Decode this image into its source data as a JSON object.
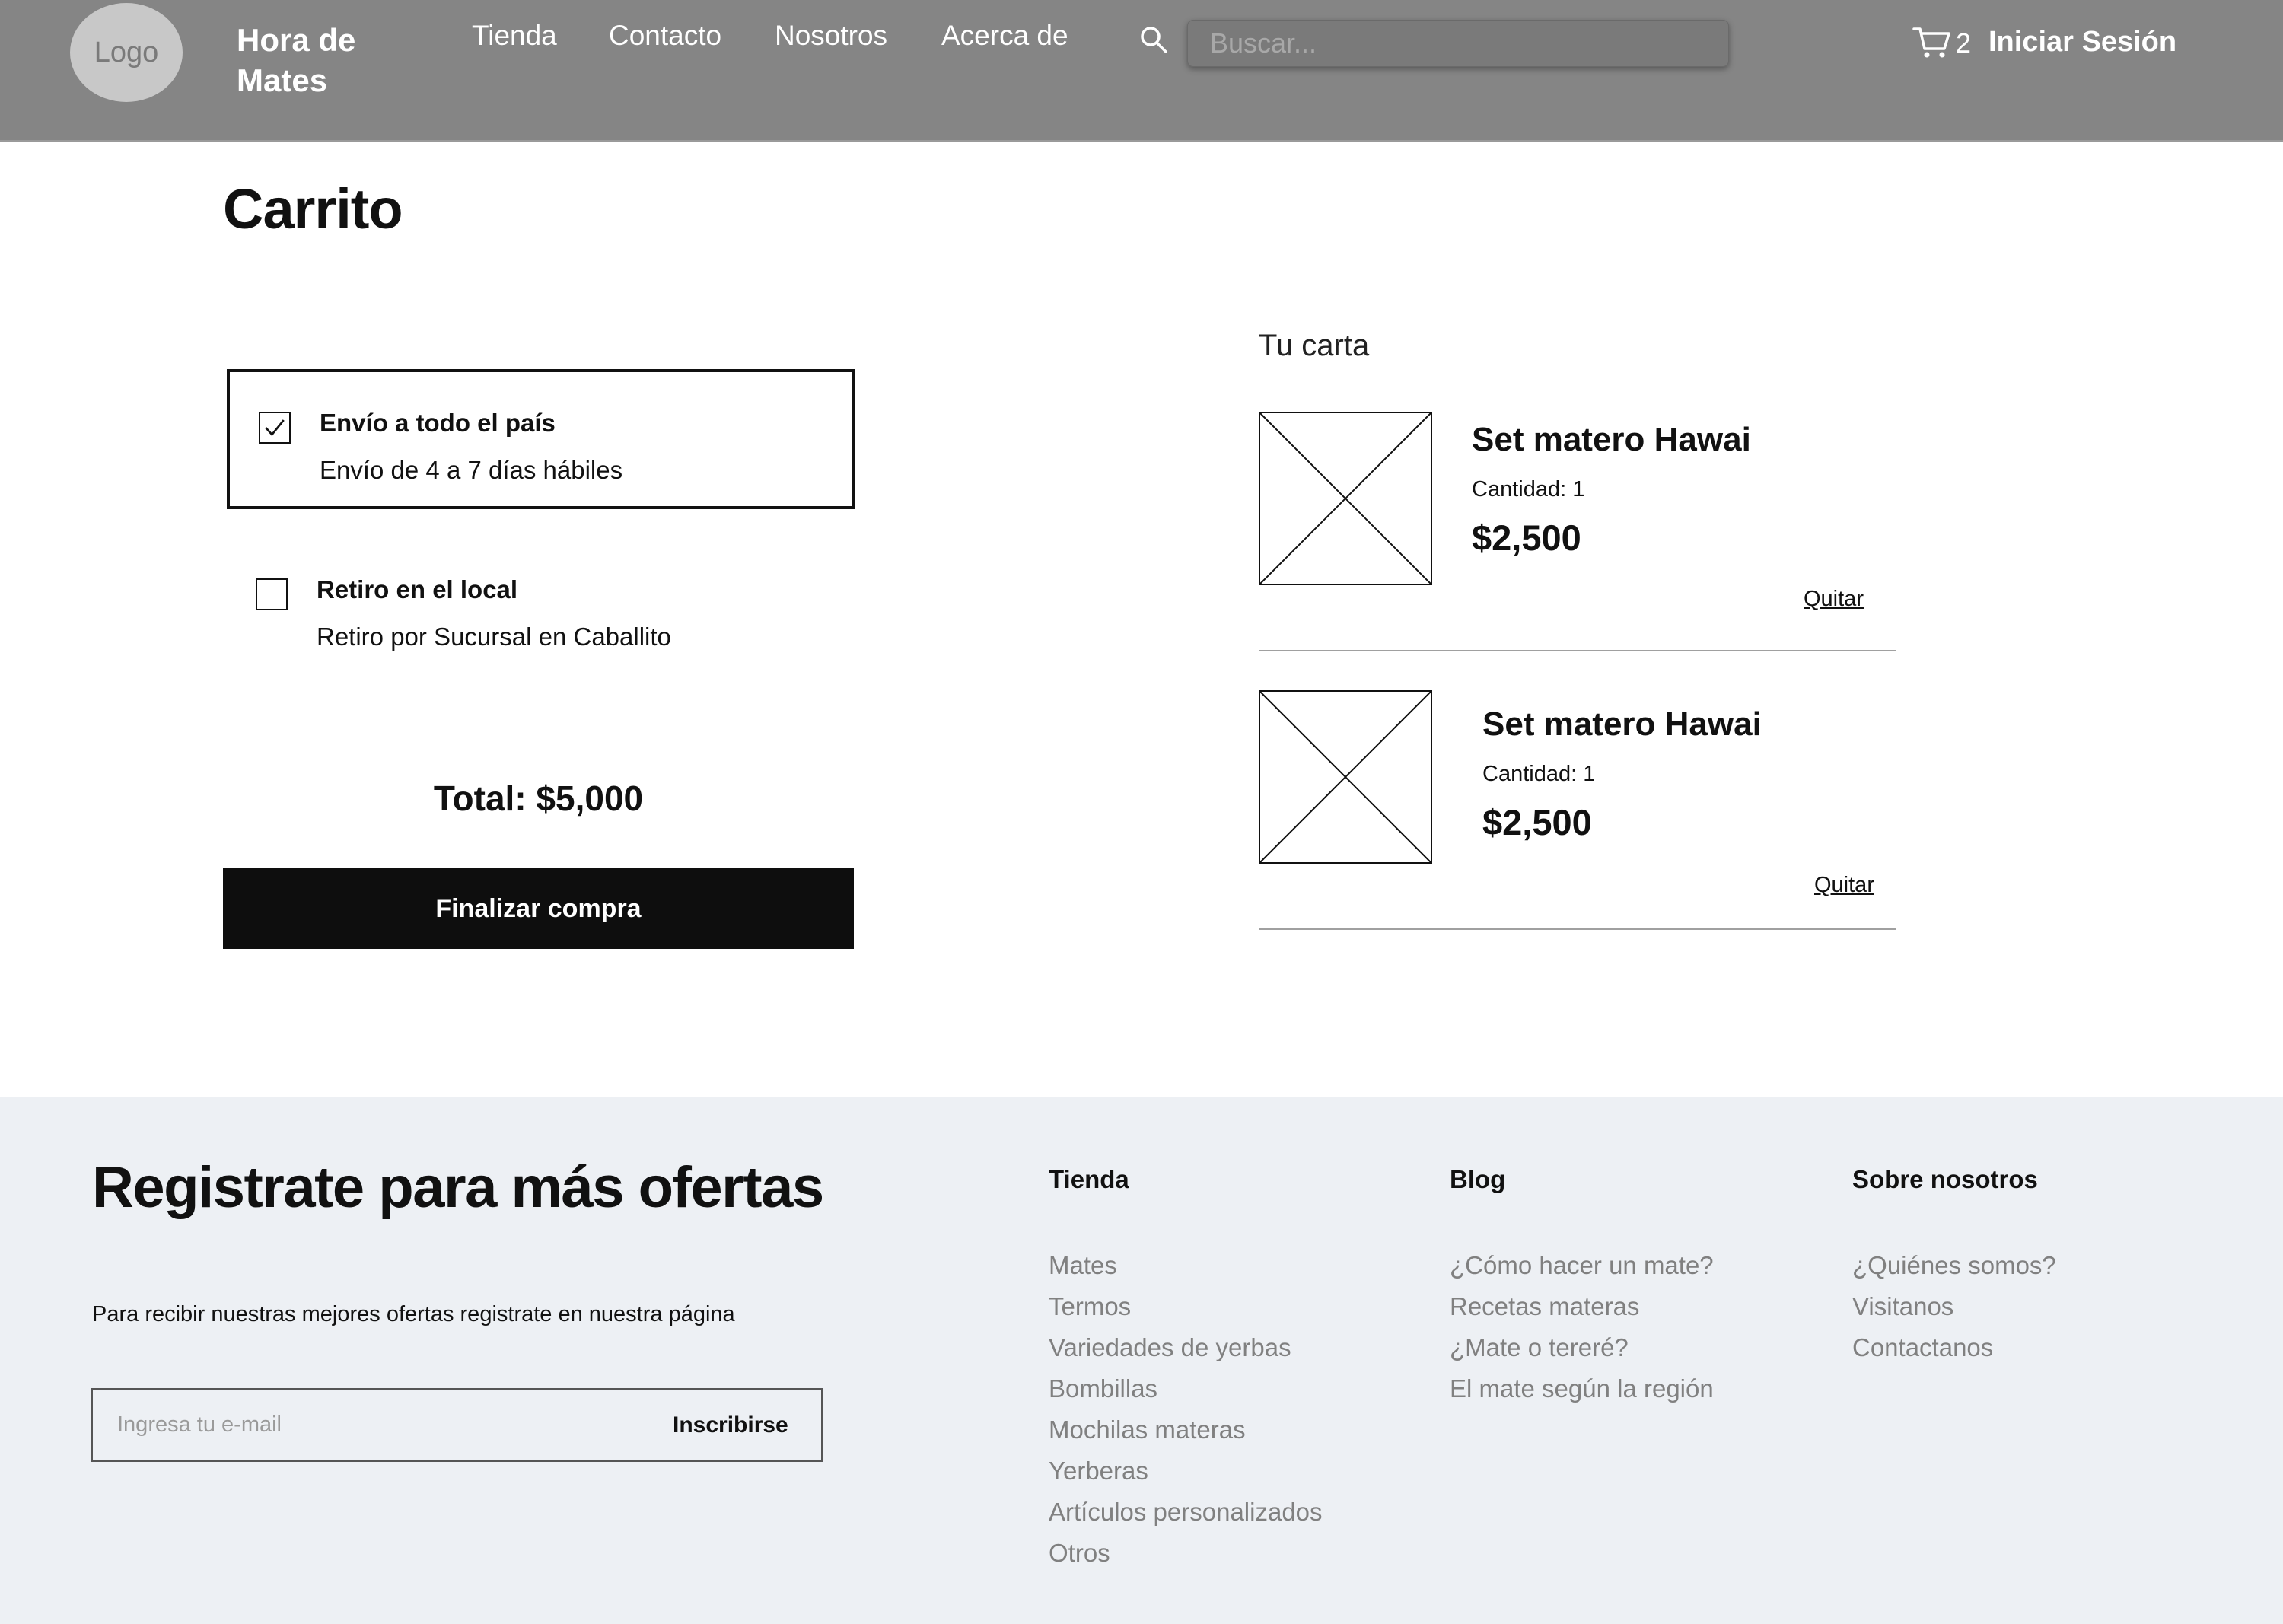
{
  "header": {
    "logo_text": "Logo",
    "brand": "Hora de Mates",
    "nav": [
      "Tienda",
      "Contacto",
      "Nosotros",
      "Acerca de"
    ],
    "search_placeholder": "Buscar...",
    "cart_count": "2",
    "login_label": "Iniciar Sesión",
    "icons": [
      "search-icon",
      "cart-icon"
    ]
  },
  "cart_page": {
    "title": "Carrito",
    "shipping_options": [
      {
        "title": "Envío a todo el país",
        "subtitle": "Envío de 4 a 7 días hábiles",
        "checked": true
      },
      {
        "title": "Retiro en el local",
        "subtitle": "Retiro por Sucursal en Caballito",
        "checked": false
      }
    ],
    "total": "Total: $5,000",
    "checkout_label": "Finalizar compra",
    "cart_heading": "Tu carta",
    "items": [
      {
        "name": "Set matero Hawai",
        "quantity": "Cantidad: 1",
        "price": "$2,500",
        "remove_label": "Quitar"
      },
      {
        "name": "Set matero Hawai",
        "quantity": "Cantidad: 1",
        "price": "$2,500",
        "remove_label": "Quitar"
      }
    ]
  },
  "footer": {
    "title": "Registrate para más ofertas",
    "text": "Para recibir nuestras mejores ofertas registrate en nuestra página",
    "email_placeholder": "Ingresa tu e-mail",
    "subscribe_label": "Inscribirse",
    "columns": [
      {
        "title": "Tienda",
        "links": [
          "Mates",
          "Termos",
          "Variedades de yerbas",
          "Bombillas",
          "Mochilas materas",
          "Yerberas",
          "Artículos personalizados",
          "Otros"
        ]
      },
      {
        "title": "Blog",
        "links": [
          "¿Cómo hacer un mate?",
          "Recetas materas",
          "¿Mate o tereré?",
          "El mate según la región"
        ]
      },
      {
        "title": "Sobre nosotros",
        "links": [
          "¿Quiénes somos?",
          "Visitanos",
          "Contactanos"
        ]
      }
    ]
  },
  "colors": {
    "header_bg": "#858585",
    "footer_bg": "#edf0f4",
    "button_bg": "#0e0e0e",
    "link_muted": "#808080"
  }
}
